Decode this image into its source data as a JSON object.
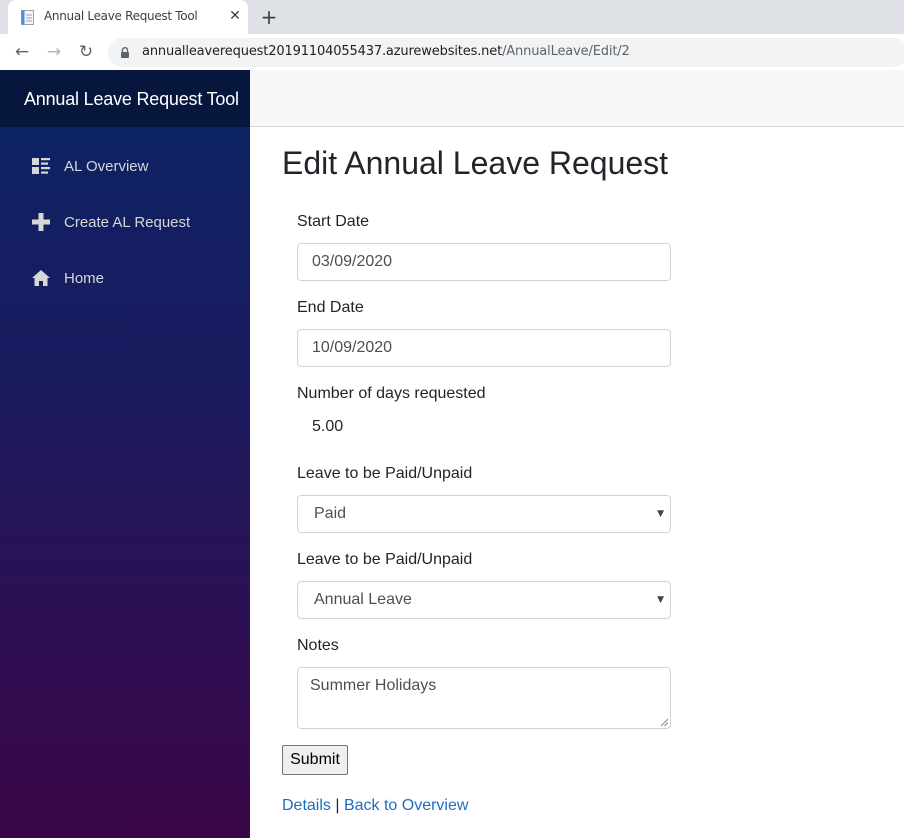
{
  "browser": {
    "tab_title": "Annual Leave Request Tool",
    "tab_close_glyph": "✕",
    "new_tab_glyph": "+",
    "back_glyph": "←",
    "forward_glyph": "→",
    "reload_glyph": "↻",
    "url_host": "annualleaverequest20191104055437.azurewebsites.net",
    "url_path": "/AnnualLeave/Edit/2"
  },
  "sidebar": {
    "brand": "Annual Leave Request Tool",
    "items": [
      {
        "label": "AL Overview",
        "icon": "list-icon"
      },
      {
        "label": "Create AL Request",
        "icon": "plus-icon"
      },
      {
        "label": "Home",
        "icon": "home-icon"
      }
    ]
  },
  "main": {
    "title": "Edit Annual Leave Request",
    "fields": {
      "start_date": {
        "label": "Start Date",
        "value": "03/09/2020"
      },
      "end_date": {
        "label": "End Date",
        "value": "10/09/2020"
      },
      "days": {
        "label": "Number of days requested",
        "value": "5.00"
      },
      "paid": {
        "label": "Leave to be Paid/Unpaid",
        "value": "Paid"
      },
      "leave_type": {
        "label": "Leave to be Paid/Unpaid",
        "value": "Annual Leave"
      },
      "notes": {
        "label": "Notes",
        "value": "Summer Holidays"
      }
    },
    "submit_label": "Submit",
    "links": {
      "details": "Details",
      "separator": " | ",
      "back": "Back to Overview"
    }
  },
  "colors": {
    "link": "#1b6ec2",
    "sidebar_top": "#0b2566",
    "sidebar_bottom": "#3a0647",
    "brand_bar": "#06163d"
  }
}
